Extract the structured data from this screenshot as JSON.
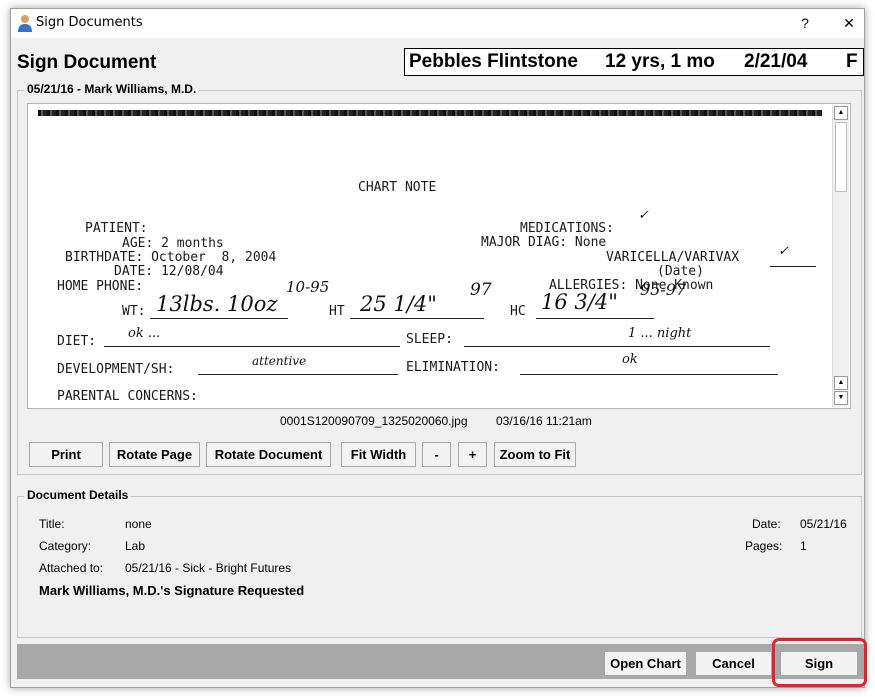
{
  "window": {
    "title": "Sign Documents",
    "help_glyph": "?",
    "close_glyph": "✕"
  },
  "header": {
    "title": "Sign Document",
    "patient": {
      "name": "Pebbles Flintstone",
      "age": "12 yrs, 1 mo",
      "dob": "2/21/04",
      "sex": "F"
    }
  },
  "document_group": {
    "legend": "05/21/16 - Mark Williams, M.D."
  },
  "scan": {
    "title": "CHART NOTE",
    "lines": {
      "patient": "PATIENT:",
      "age": "AGE: 2 months",
      "birthdate": "BIRTHDATE: October  8, 2004",
      "date": "DATE: 12/08/04",
      "home_phone": "HOME PHONE:",
      "medications": "MEDICATIONS:",
      "major_diag": "MAJOR DIAG: None",
      "varicella": "VARICELLA/VARIVAX",
      "date_paren": "(Date)",
      "allergies": "ALLERGIES: None Known",
      "wt": "WT:",
      "ht": "HT",
      "hc": "HC",
      "diet": "DIET:",
      "sleep": "SLEEP:",
      "development": "DEVELOPMENT/SH:",
      "elimination": "ELIMINATION:",
      "parental": "PARENTAL CONCERNS:"
    },
    "handwriting": {
      "wt": "13lbs. 10oz",
      "wt_pct": "10-95",
      "ht": "25 1/4\"",
      "ht_pct": "97",
      "hc": "16 3/4\"",
      "hc_pct": "95-97",
      "diet": "ok  ...",
      "sleep": "1 ... night",
      "development": "attentive",
      "elimination": "ok",
      "medications_mark": "✓",
      "varicella_mark": "✓"
    }
  },
  "file_info": {
    "filename": "0001S120090709_1325020060.jpg",
    "timestamp": "03/16/16 11:21am"
  },
  "toolbar": {
    "print": "Print",
    "rotate_page": "Rotate Page",
    "rotate_document": "Rotate Document",
    "fit_width": "Fit Width",
    "zoom_out": "-",
    "zoom_in": "+",
    "zoom_to_fit": "Zoom to Fit"
  },
  "details": {
    "legend": "Document Details",
    "title_label": "Title:",
    "title_value": "none",
    "category_label": "Category:",
    "category_value": "Lab",
    "attached_label": "Attached to:",
    "attached_value": "05/21/16 - Sick - Bright Futures",
    "date_label": "Date:",
    "date_value": "05/21/16",
    "pages_label": "Pages:",
    "pages_value": "1",
    "signature_status": "Mark Williams, M.D.'s Signature Requested"
  },
  "footer": {
    "open_chart": "Open Chart",
    "cancel": "Cancel",
    "sign": "Sign"
  },
  "colors": {
    "highlight": "#e0232e",
    "footer_bar": "#a8a8a8"
  }
}
